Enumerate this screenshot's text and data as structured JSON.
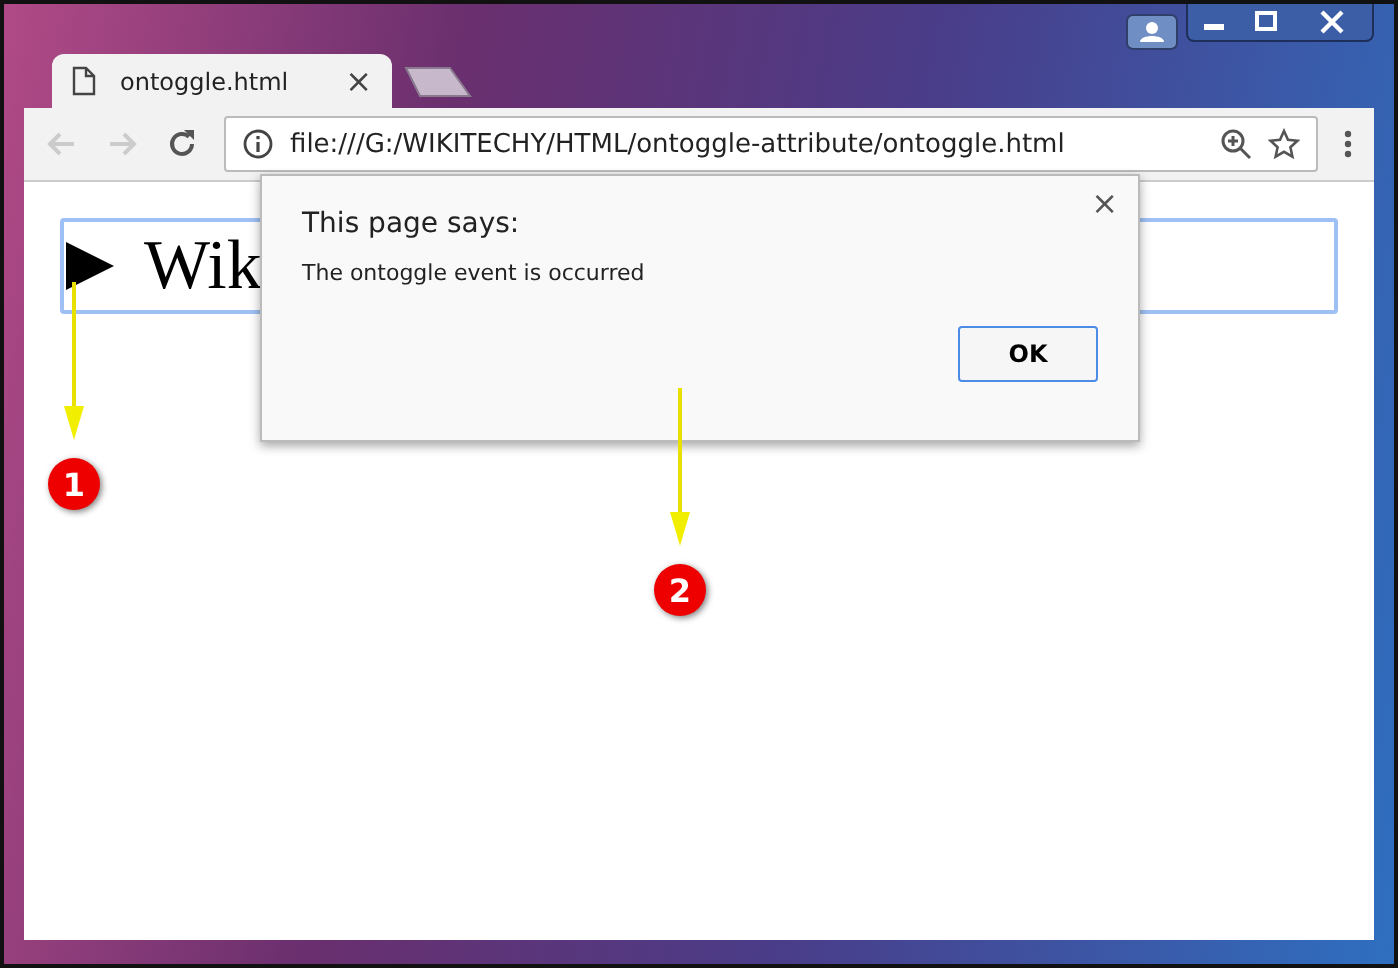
{
  "tabs": [
    {
      "title": "ontoggle.html",
      "close": "×",
      "selected": true
    }
  ],
  "address_bar": {
    "url": "file:///G:/WIKITECHY/HTML/ontoggle-attribute/ontoggle.html"
  },
  "details": {
    "summary": "Wik",
    "expanded": false
  },
  "dialog": {
    "title": "This page says:",
    "message": "The ontoggle event is occurred",
    "close": "×",
    "button": "OK"
  },
  "callouts": [
    "1",
    "2"
  ]
}
